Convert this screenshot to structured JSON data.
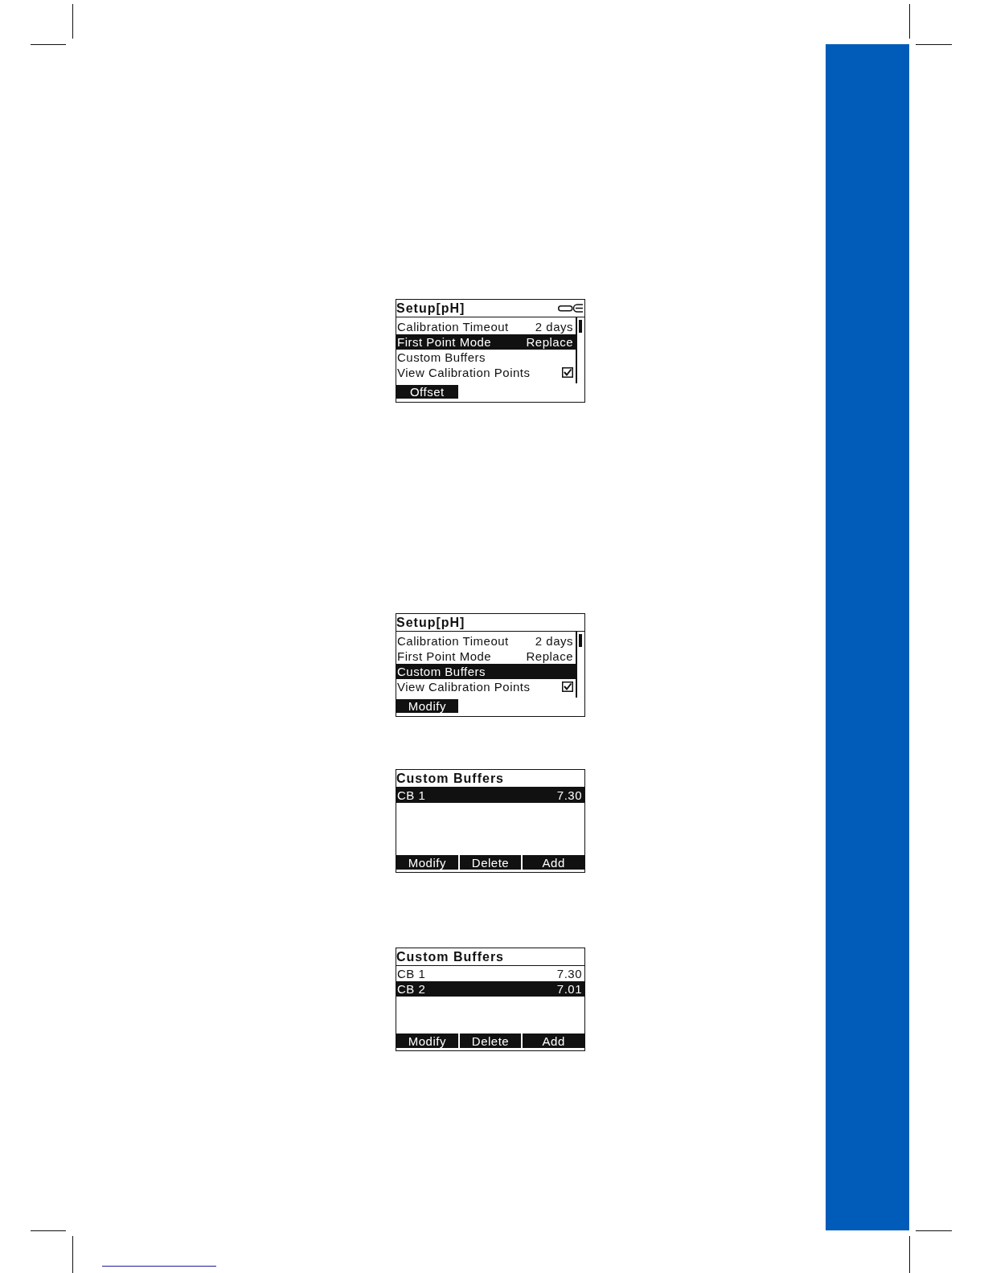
{
  "screens": [
    {
      "kind": "menu",
      "title": "Setup[pH]",
      "connector_icon": true,
      "rows": [
        {
          "kind": "setting",
          "label": "Calibration Timeout",
          "value": "2 days",
          "selected": false
        },
        {
          "kind": "setting",
          "label": "First Point Mode",
          "value": "Replace",
          "selected": true
        },
        {
          "kind": "setting",
          "label": "Custom Buffers",
          "selected": false
        },
        {
          "kind": "checkbox",
          "label": "View Calibration Points",
          "checked": true,
          "selected": false
        }
      ],
      "softkeys": [
        "Offset"
      ]
    },
    {
      "kind": "menu",
      "title": "Setup[pH]",
      "connector_icon": false,
      "rows": [
        {
          "kind": "setting",
          "label": "Calibration Timeout",
          "value": "2 days",
          "selected": false
        },
        {
          "kind": "setting",
          "label": "First Point Mode",
          "value": "Replace",
          "selected": false
        },
        {
          "kind": "setting",
          "label": "Custom Buffers",
          "selected": true
        },
        {
          "kind": "checkbox",
          "label": "View Calibration Points",
          "checked": true,
          "selected": false
        }
      ],
      "softkeys": [
        "Modify"
      ]
    },
    {
      "kind": "list",
      "title": "Custom Buffers",
      "connector_icon": false,
      "rows": [
        {
          "kind": "setting",
          "label": "CB 1",
          "value": "7.30",
          "selected": true
        }
      ],
      "softkeys": [
        "Modify",
        "Delete",
        "Add"
      ]
    },
    {
      "kind": "list",
      "title": "Custom Buffers",
      "connector_icon": false,
      "rows": [
        {
          "kind": "setting",
          "label": "CB 1",
          "value": "7.30",
          "selected": false
        },
        {
          "kind": "setting",
          "label": "CB 2",
          "value": "7.01",
          "selected": true
        }
      ],
      "softkeys": [
        "Modify",
        "Delete",
        "Add"
      ]
    }
  ]
}
